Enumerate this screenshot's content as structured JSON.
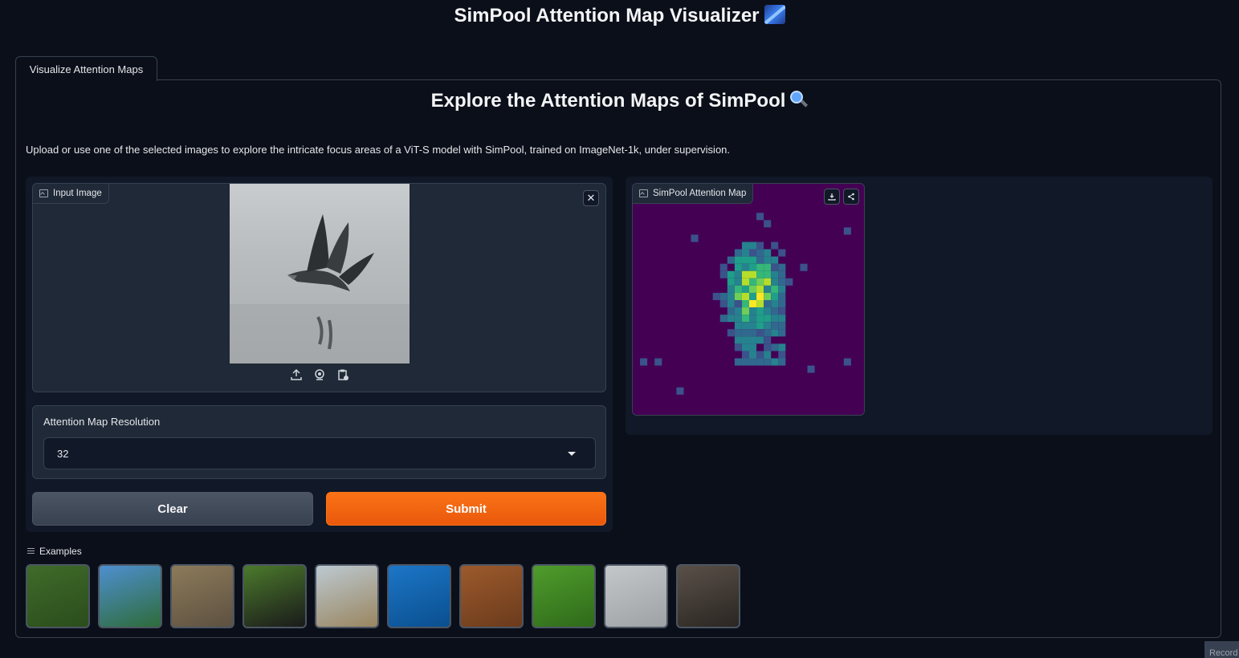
{
  "app_title": "SimPool Attention Map Visualizer",
  "tabs": [
    {
      "label": "Visualize Attention Maps",
      "active": true
    }
  ],
  "heading": "Explore the Attention Maps of SimPool",
  "description": "Upload or use one of the selected images to explore the intricate focus areas of a ViT-S model with SimPool, trained on ImageNet-1k, under supervision.",
  "input_image": {
    "label": "Input Image",
    "source_icons": [
      "upload-icon",
      "webcam-icon",
      "clipboard-icon"
    ]
  },
  "resolution": {
    "label": "Attention Map Resolution",
    "value": "32"
  },
  "buttons": {
    "clear": "Clear",
    "submit": "Submit"
  },
  "output": {
    "label": "SimPool Attention Map",
    "actions": [
      "download-icon",
      "share-icon"
    ]
  },
  "examples": {
    "label": "Examples",
    "items": [
      {
        "name": "example-birds-perched",
        "colors": [
          "#3f6b2a",
          "#2b4d1c"
        ]
      },
      {
        "name": "example-ostrich-sky",
        "colors": [
          "#4e8fd0",
          "#2e6c3a"
        ]
      },
      {
        "name": "example-bird-ground",
        "colors": [
          "#8c7a5a",
          "#5d5140"
        ]
      },
      {
        "name": "example-magpie",
        "colors": [
          "#4b7a2c",
          "#1a1a1a"
        ]
      },
      {
        "name": "example-savanna",
        "colors": [
          "#bcc9d1",
          "#9a8660"
        ]
      },
      {
        "name": "example-shark",
        "colors": [
          "#1c76c7",
          "#0a4f8f"
        ]
      },
      {
        "name": "example-purple-creature",
        "colors": [
          "#9c5a2c",
          "#6b3b1c"
        ]
      },
      {
        "name": "example-grass-insect",
        "colors": [
          "#4f9c2c",
          "#2f6a1a"
        ]
      },
      {
        "name": "example-birds-water",
        "colors": [
          "#c4c7c9",
          "#9ea2a4"
        ]
      },
      {
        "name": "example-beagle",
        "colors": [
          "#5a5048",
          "#2a2622"
        ]
      }
    ]
  },
  "record_tag": "Record",
  "colors": {
    "background": "#0b0f19",
    "panel": "#111827",
    "block": "#1f2937",
    "accent_orange": "#f97316",
    "viridis_low": "#440154",
    "viridis_high": "#fde725"
  }
}
